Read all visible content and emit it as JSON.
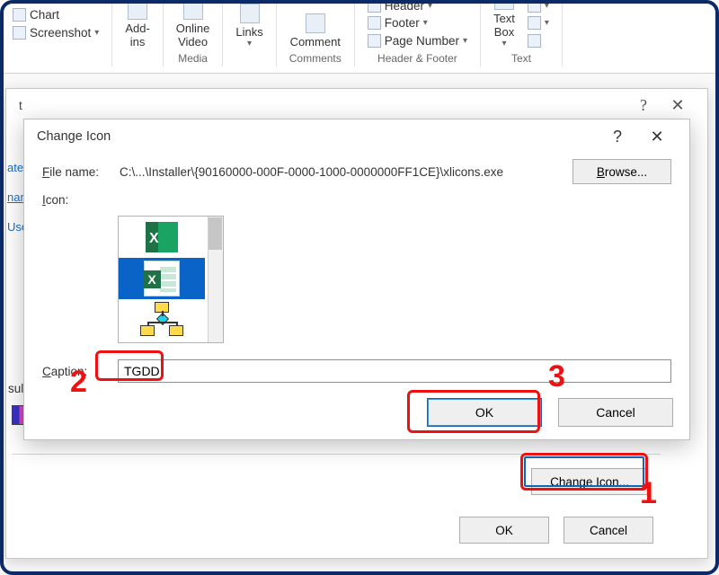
{
  "ribbon": {
    "chart_label": "Chart",
    "screenshot_label": "Screenshot",
    "addins_label": "Add-\nins",
    "online_video_label": "Online\nVideo",
    "media_group": "Media",
    "links_label": "Links",
    "comment_label": "Comment",
    "comments_group": "Comments",
    "header_label": "Header",
    "footer_label": "Footer",
    "page_number_label": "Page Number",
    "header_footer_group": "Header & Footer",
    "text_box_label": "Text\nBox",
    "text_group": "Text"
  },
  "parent_dialog": {
    "title_suffix": "t",
    "help": "?",
    "close": "✕",
    "side": {
      "create": "ate",
      "filename": "name",
      "user": "Use"
    },
    "result_label": "sult",
    "change_icon_btn": "Change Icon...",
    "ok": "OK",
    "cancel": "Cancel"
  },
  "dialog": {
    "title": "Change Icon",
    "help": "?",
    "close": "✕",
    "file_name_label": "File name:",
    "file_name_value": "C:\\...\\Installer\\{90160000-000F-0000-1000-0000000FF1CE}\\xlicons.exe",
    "browse": "Browse...",
    "icon_label": "Icon:",
    "caption_label": "Caption:",
    "caption_value": "TGDD",
    "ok": "OK",
    "cancel": "Cancel"
  },
  "callouts": {
    "n1": "1",
    "n2": "2",
    "n3": "3"
  }
}
